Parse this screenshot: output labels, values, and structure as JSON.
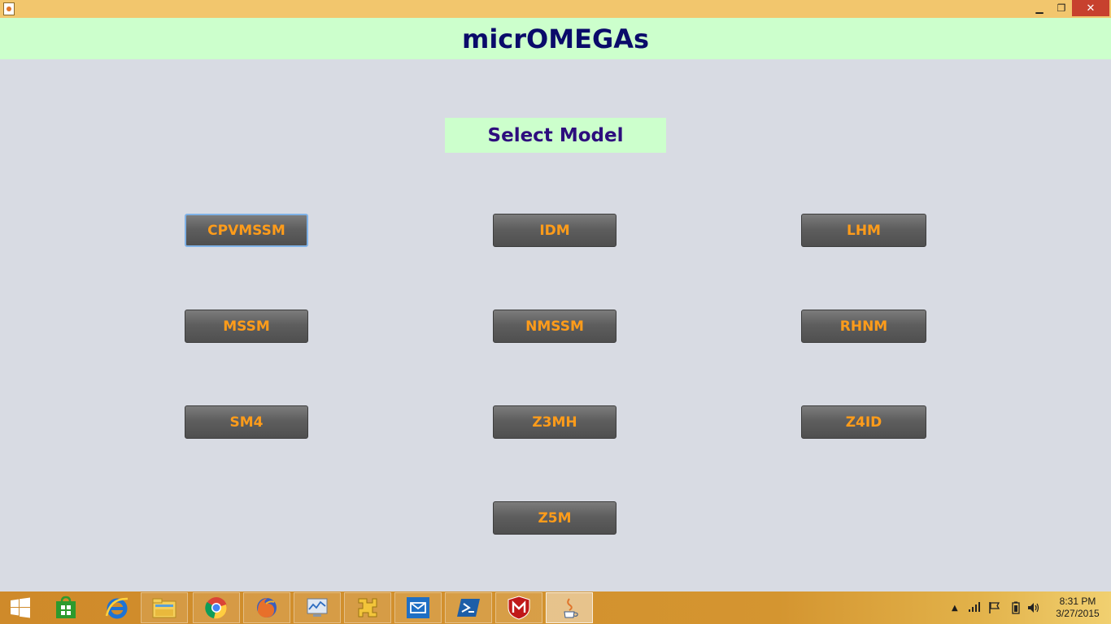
{
  "window": {
    "minimize_glyph": "▁",
    "maximize_glyph": "❐",
    "close_glyph": "✕"
  },
  "app": {
    "title": "micrOMEGAs"
  },
  "select_model": {
    "label": "Select Model"
  },
  "models": {
    "cpvmssm": "CPVMSSM",
    "idm": "IDM",
    "lhm": "LHM",
    "mssm": "MSSM",
    "nmssm": "NMSSM",
    "rhnm": "RHNM",
    "sm4": "SM4",
    "z3mh": "Z3MH",
    "z4id": "Z4ID",
    "z5m": "Z5M"
  },
  "taskbar": {
    "items": [
      "start-icon",
      "store-icon",
      "internet-explorer-icon",
      "file-explorer-icon",
      "chrome-icon",
      "firefox-icon",
      "performance-monitor-icon",
      "tool-icon",
      "mail-icon",
      "powershell-icon",
      "mcafee-icon",
      "java-icon"
    ],
    "clock_time": "8:31 PM",
    "clock_date": "3/27/2015"
  },
  "colors": {
    "title_bar": "#f2c66d",
    "header_bg": "#ccffcc",
    "content_bg": "#d8dbe3",
    "button_text": "#ff9c1a",
    "title_text": "#0a0a6a"
  }
}
